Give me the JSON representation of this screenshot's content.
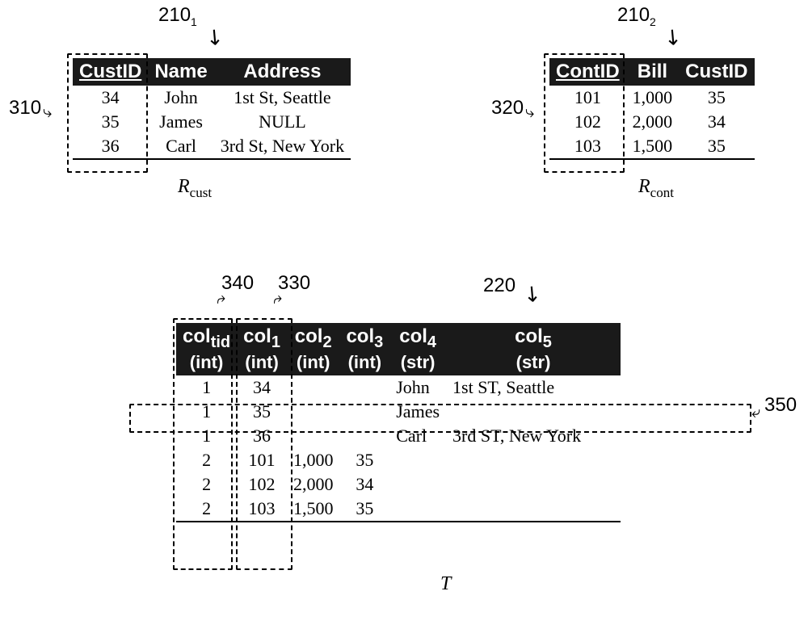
{
  "callouts": {
    "t1": "210",
    "t1sub": "1",
    "t2": "210",
    "t2sub": "2",
    "c310": "310",
    "c320": "320",
    "c340": "340",
    "c330": "330",
    "c220": "220",
    "c350": "350"
  },
  "tables": {
    "rcust": {
      "headers": [
        "CustID",
        "Name",
        "Address"
      ],
      "pkindex": 0,
      "rows": [
        [
          "34",
          "John",
          "1st St, Seattle"
        ],
        [
          "35",
          "James",
          "NULL"
        ],
        [
          "36",
          "Carl",
          "3rd St, New York"
        ]
      ],
      "label": "R",
      "labelsub": "cust"
    },
    "rcont": {
      "headers": [
        "ContID",
        "Bill",
        "CustID"
      ],
      "pkindex": 0,
      "rows": [
        [
          "101",
          "1,000",
          "35"
        ],
        [
          "102",
          "2,000",
          "34"
        ],
        [
          "103",
          "1,500",
          "35"
        ]
      ],
      "label": "R",
      "labelsub": "cont"
    },
    "T": {
      "headers": [
        {
          "l1": "col",
          "sub": "tid",
          "l2": "(int)"
        },
        {
          "l1": "col",
          "sub": "1",
          "l2": "(int)"
        },
        {
          "l1": "col",
          "sub": "2",
          "l2": "(int)"
        },
        {
          "l1": "col",
          "sub": "3",
          "l2": "(int)"
        },
        {
          "l1": "col",
          "sub": "4",
          "l2": "(str)"
        },
        {
          "l1": "col",
          "sub": "5",
          "l2": "(str)"
        }
      ],
      "rows": [
        [
          "1",
          "34",
          "",
          "",
          "John",
          "1st ST, Seattle"
        ],
        [
          "1",
          "35",
          "",
          "",
          "James",
          ""
        ],
        [
          "1",
          "36",
          "",
          "",
          "Carl",
          "3rd ST, New York"
        ],
        [
          "2",
          "101",
          "1,000",
          "35",
          "",
          ""
        ],
        [
          "2",
          "102",
          "2,000",
          "34",
          "",
          ""
        ],
        [
          "2",
          "103",
          "1,500",
          "35",
          "",
          ""
        ]
      ],
      "label": "T"
    }
  },
  "chart_data": {
    "type": "table",
    "tables": [
      {
        "name": "R_cust",
        "columns": [
          "CustID",
          "Name",
          "Address"
        ],
        "primary_key": "CustID",
        "rows": [
          {
            "CustID": 34,
            "Name": "John",
            "Address": "1st St, Seattle"
          },
          {
            "CustID": 35,
            "Name": "James",
            "Address": null
          },
          {
            "CustID": 36,
            "Name": "Carl",
            "Address": "3rd St, New York"
          }
        ]
      },
      {
        "name": "R_cont",
        "columns": [
          "ContID",
          "Bill",
          "CustID"
        ],
        "primary_key": "ContID",
        "rows": [
          {
            "ContID": 101,
            "Bill": 1000,
            "CustID": 35
          },
          {
            "ContID": 102,
            "Bill": 2000,
            "CustID": 34
          },
          {
            "ContID": 103,
            "Bill": 1500,
            "CustID": 35
          }
        ]
      },
      {
        "name": "T",
        "columns": [
          "col_tid",
          "col_1",
          "col_2",
          "col_3",
          "col_4",
          "col_5"
        ],
        "column_types": [
          "int",
          "int",
          "int",
          "int",
          "str",
          "str"
        ],
        "rows": [
          {
            "col_tid": 1,
            "col_1": 34,
            "col_2": null,
            "col_3": null,
            "col_4": "John",
            "col_5": "1st ST, Seattle"
          },
          {
            "col_tid": 1,
            "col_1": 35,
            "col_2": null,
            "col_3": null,
            "col_4": "James",
            "col_5": null
          },
          {
            "col_tid": 1,
            "col_1": 36,
            "col_2": null,
            "col_3": null,
            "col_4": "Carl",
            "col_5": "3rd ST, New York"
          },
          {
            "col_tid": 2,
            "col_1": 101,
            "col_2": 1000,
            "col_3": 35,
            "col_4": null,
            "col_5": null
          },
          {
            "col_tid": 2,
            "col_1": 102,
            "col_2": 2000,
            "col_3": 34,
            "col_4": null,
            "col_5": null
          },
          {
            "col_tid": 2,
            "col_1": 103,
            "col_2": 1500,
            "col_3": 35,
            "col_4": null,
            "col_5": null
          }
        ]
      }
    ],
    "annotations": {
      "210_1": "points to R_cust table",
      "210_2": "points to R_cont table",
      "310": "highlights CustID column of R_cust",
      "320": "highlights ContID column of R_cont",
      "340": "highlights col_tid column of T",
      "330": "highlights col_1 column of T",
      "220": "points to table T",
      "350": "highlights second row of T"
    }
  }
}
